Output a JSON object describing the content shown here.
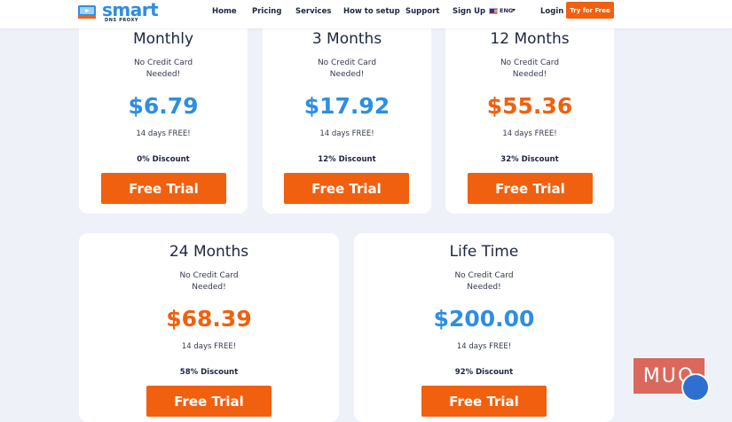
{
  "header": {
    "logo_word": "smart",
    "logo_sub": "DNS PROXY",
    "nav": [
      "Home",
      "Pricing",
      "Services",
      "How to setup",
      "Support",
      "Sign Up"
    ],
    "language": "ENG",
    "login": "Login",
    "cta": "Try for Free"
  },
  "plans": [
    {
      "name": "Monthly",
      "note1": "No Credit Card",
      "note2": "Needed!",
      "price": "$6.79",
      "price_color": "#2d8ee3",
      "free": "14 days FREE!",
      "discount": "0% Discount",
      "button": "Free Trial"
    },
    {
      "name": "3 Months",
      "note1": "No Credit Card",
      "note2": "Needed!",
      "price": "$17.92",
      "price_color": "#2d8ee3",
      "free": "14 days FREE!",
      "discount": "12% Discount",
      "button": "Free Trial"
    },
    {
      "name": "12 Months",
      "note1": "No Credit Card",
      "note2": "Needed!",
      "price": "$55.36",
      "price_color": "#f0600f",
      "free": "14 days FREE!",
      "discount": "32% Discount",
      "button": "Free Trial"
    },
    {
      "name": "24 Months",
      "note1": "No Credit Card",
      "note2": "Needed!",
      "price": "$68.39",
      "price_color": "#f0600f",
      "free": "14 days FREE!",
      "discount": "58% Discount",
      "button": "Free Trial"
    },
    {
      "name": "Life Time",
      "note1": "No Credit Card",
      "note2": "Needed!",
      "price": "$200.00",
      "price_color": "#2d8ee3",
      "free": "14 days FREE!",
      "discount": "92% Discount",
      "button": "Free Trial"
    }
  ],
  "colors": {
    "accent": "#f0600f",
    "blue": "#2d8ee3",
    "background": "#eef1f8"
  },
  "watermark": "MUO"
}
